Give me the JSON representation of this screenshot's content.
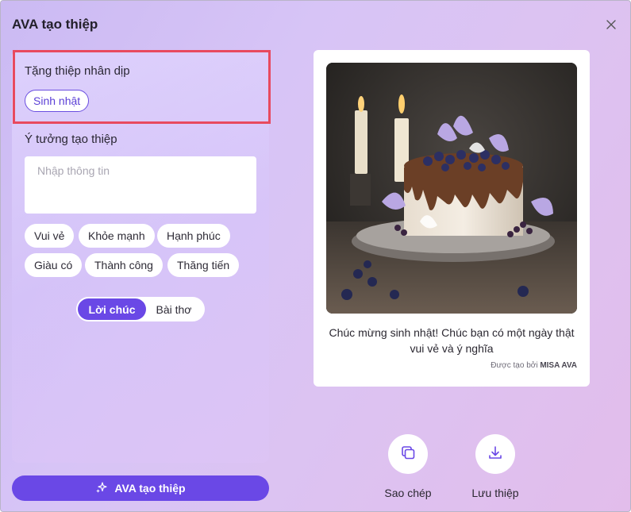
{
  "window": {
    "title": "AVA tạo thiệp"
  },
  "occasion": {
    "label": "Tặng thiệp nhân dịp",
    "selected": "Sinh nhật"
  },
  "ideas": {
    "label": "Ý tưởng tạo thiệp",
    "placeholder": "Nhập thông tin",
    "value": "",
    "tags": [
      "Vui vẻ",
      "Khỏe mạnh",
      "Hạnh phúc",
      "Giàu có",
      "Thành công",
      "Thăng tiến"
    ]
  },
  "type_toggle": {
    "options": [
      "Lời chúc",
      "Bài thơ"
    ],
    "selected": "Lời chúc"
  },
  "create_button": {
    "label": "AVA tạo thiệp"
  },
  "card": {
    "wish_text": "Chúc mừng sinh nhật! Chúc bạn có một ngày thật vui vẻ và ý nghĩa",
    "credit_prefix": "Được tạo bởi",
    "credit_brand": "MISA AVA"
  },
  "actions": {
    "copy_label": "Sao chép",
    "save_label": "Lưu thiệp"
  },
  "colors": {
    "accent": "#6a48e6",
    "highlight_border": "#e84a5f"
  },
  "icons": [
    "close-icon",
    "sparkle-icon",
    "copy-icon",
    "download-icon"
  ]
}
